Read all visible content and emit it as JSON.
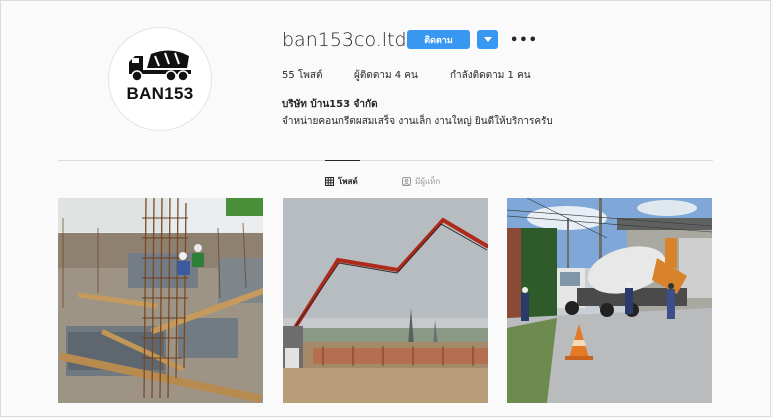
{
  "profile": {
    "username": "ban153co.ltd",
    "follow_label": "ติดตาม",
    "brand_text": "BAN153",
    "stats": {
      "posts": "55 โพสต์",
      "followers": "ผู้ติดตาม 4 คน",
      "following": "กำลังติดตาม 1 คน"
    },
    "full_name": "บริษัท บ้าน153 จำกัด",
    "bio": "จำหน่ายคอนกรีตผสมเสร็จ งานเล็ก งานใหญ่ ยินดีให้บริการครับ"
  },
  "tabs": [
    {
      "label": "โพสต์",
      "icon": "grid-icon",
      "active": true
    },
    {
      "label": "มีผู้แท็ก",
      "icon": "tagged-icon",
      "active": false
    }
  ],
  "posts": [
    {
      "description": "construction-rebar-site"
    },
    {
      "description": "concrete-pump-truck"
    },
    {
      "description": "concrete-mixer-truck-street"
    }
  ],
  "colors": {
    "accent": "#3897f0",
    "background": "#fafafa"
  }
}
